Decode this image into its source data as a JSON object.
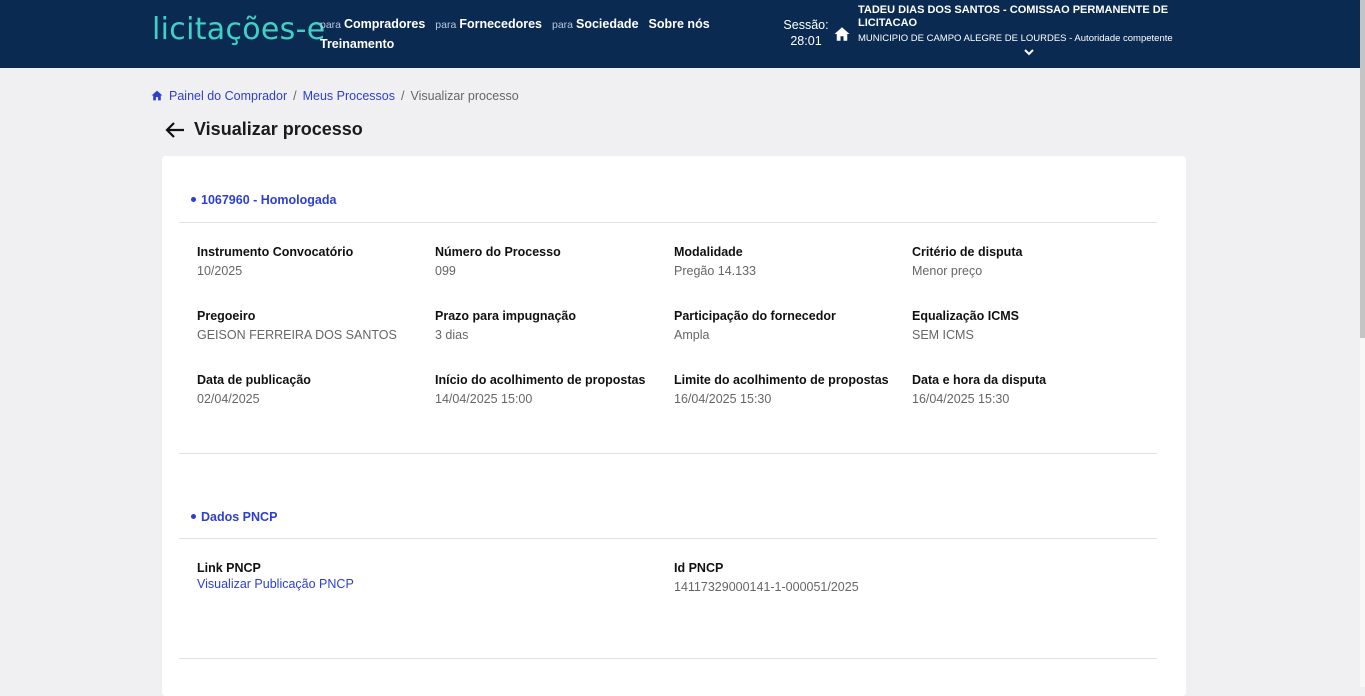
{
  "header": {
    "logo": "licitações-e",
    "nav": [
      {
        "prefix": "para",
        "label": "Compradores"
      },
      {
        "prefix": "para",
        "label": "Fornecedores"
      },
      {
        "prefix": "para",
        "label": "Sociedade"
      },
      {
        "prefix": "",
        "label": "Sobre nós"
      },
      {
        "prefix": "",
        "label": "Treinamento"
      }
    ],
    "session_label": "Sessão:",
    "session_time": "28:01",
    "user_name": "TADEU DIAS DOS SANTOS - COMISSAO PERMANENTE DE LICITACAO",
    "user_org": "MUNICIPIO DE CAMPO ALEGRE DE LOURDES - Autoridade competente"
  },
  "breadcrumb": {
    "items": [
      "Painel do Comprador",
      "Meus Processos"
    ],
    "separator": "/",
    "current": "Visualizar processo"
  },
  "page_title": "Visualizar processo",
  "process_section": {
    "title": "1067960 - Homologada",
    "fields": [
      {
        "label": "Instrumento Convocatório",
        "value": "10/2025"
      },
      {
        "label": "Número do Processo",
        "value": "099"
      },
      {
        "label": "Modalidade",
        "value": "Pregão 14.133"
      },
      {
        "label": "Critério de disputa",
        "value": "Menor preço"
      },
      {
        "label": "Pregoeiro",
        "value": "GEISON FERREIRA DOS SANTOS"
      },
      {
        "label": "Prazo para impugnação",
        "value": "3 dias"
      },
      {
        "label": "Participação do fornecedor",
        "value": "Ampla"
      },
      {
        "label": "Equalização ICMS",
        "value": "SEM ICMS"
      },
      {
        "label": "Data de publicação",
        "value": "02/04/2025"
      },
      {
        "label": "Início do acolhimento de propostas",
        "value": "14/04/2025 15:00"
      },
      {
        "label": "Limite do acolhimento de propostas",
        "value": "16/04/2025 15:30"
      },
      {
        "label": "Data e hora da disputa",
        "value": "16/04/2025 15:30"
      }
    ]
  },
  "pncp_section": {
    "title": "Dados PNCP",
    "link_label": "Link PNCP",
    "link_text": "Visualizar Publicação PNCP",
    "id_label": "Id PNCP",
    "id_value": "14117329000141-1-000051/2025"
  },
  "colors": {
    "header_bg": "#0a2a52",
    "logo": "#3fd1c5",
    "accent": "#2d3fcf",
    "page_bg": "#f0f0f2"
  },
  "icons": [
    "home-icon",
    "chevron-down-icon",
    "arrow-left-icon",
    "breadcrumb-home-icon"
  ]
}
